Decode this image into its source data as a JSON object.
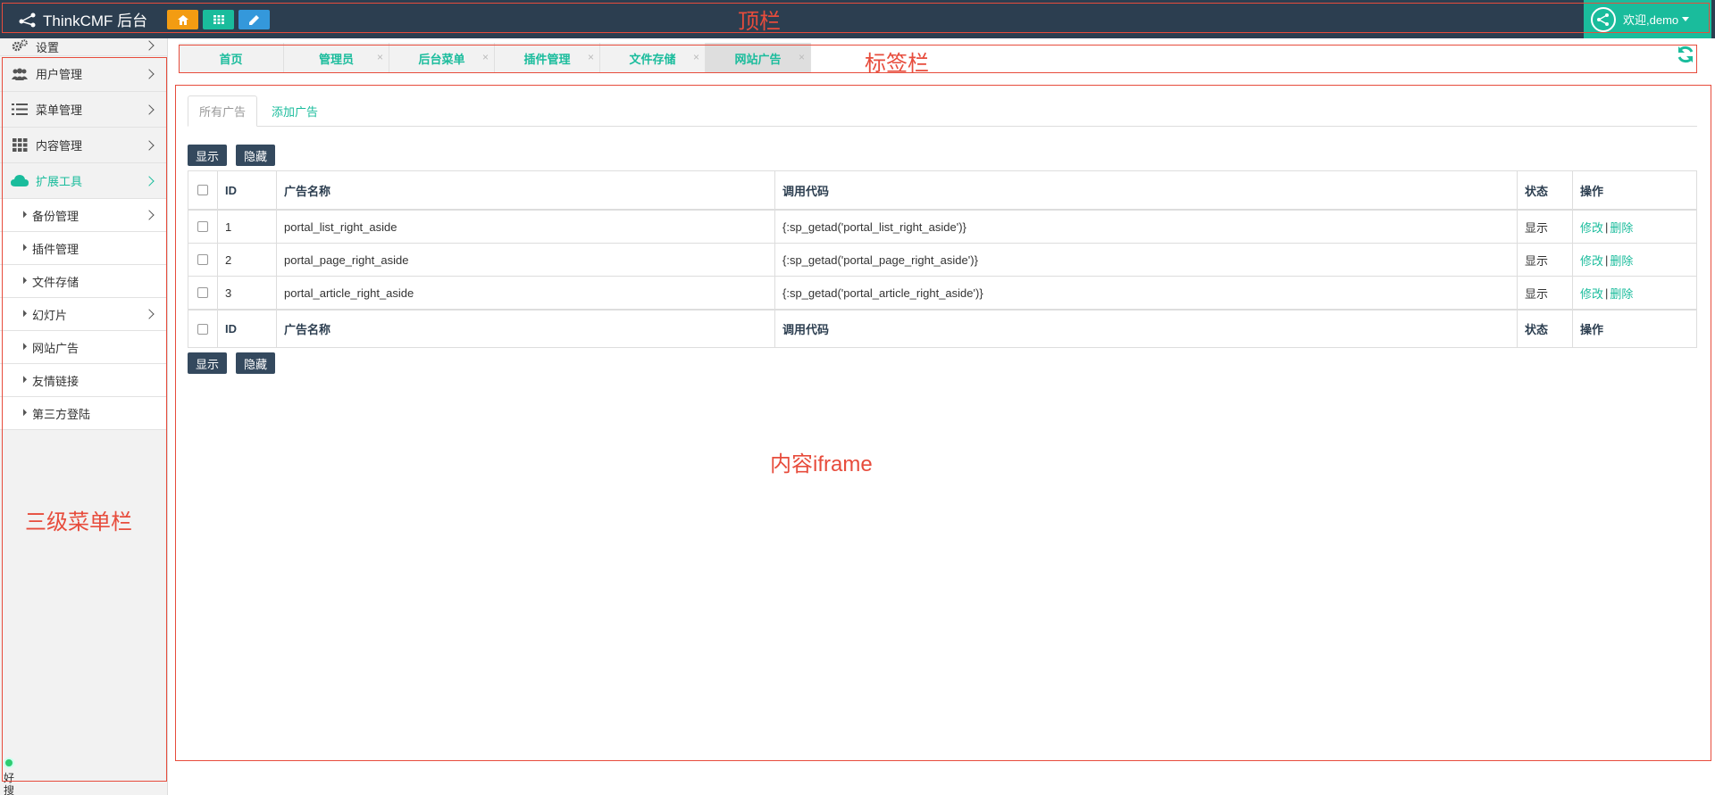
{
  "topbar": {
    "brand": "ThinkCMF 后台",
    "welcome": "欢迎,demo"
  },
  "sidebar": {
    "menus": [
      {
        "label": "设置",
        "icon": "gears-icon"
      },
      {
        "label": "用户管理",
        "icon": "users-icon"
      },
      {
        "label": "菜单管理",
        "icon": "list-icon"
      },
      {
        "label": "内容管理",
        "icon": "grid-icon"
      },
      {
        "label": "扩展工具",
        "icon": "cloud-icon"
      }
    ],
    "submenus": [
      {
        "label": "备份管理",
        "has_children": true
      },
      {
        "label": "插件管理",
        "has_children": false
      },
      {
        "label": "文件存储",
        "has_children": false
      },
      {
        "label": "幻灯片",
        "has_children": true
      },
      {
        "label": "网站广告",
        "has_children": false
      },
      {
        "label": "友情链接",
        "has_children": false
      },
      {
        "label": "第三方登陆",
        "has_children": false
      }
    ],
    "haosou": "好搜推荐"
  },
  "tabs": [
    {
      "label": "首页",
      "closable": false
    },
    {
      "label": "管理员",
      "closable": true
    },
    {
      "label": "后台菜单",
      "closable": true
    },
    {
      "label": "插件管理",
      "closable": true
    },
    {
      "label": "文件存储",
      "closable": true
    },
    {
      "label": "网站广告",
      "closable": true,
      "active": true
    }
  ],
  "tab_close_glyph": "×",
  "content": {
    "nav": {
      "all": "所有广告",
      "add": "添加广告"
    },
    "buttons": {
      "show": "显示",
      "hide": "隐藏"
    },
    "columns": {
      "id": "ID",
      "name": "广告名称",
      "code": "调用代码",
      "status": "状态",
      "ops": "操作"
    },
    "rows": [
      {
        "id": "1",
        "name": "portal_list_right_aside",
        "code": "{:sp_getad('portal_list_right_aside')}",
        "status": "显示",
        "edit": "修改",
        "delete": "删除"
      },
      {
        "id": "2",
        "name": "portal_page_right_aside",
        "code": "{:sp_getad('portal_page_right_aside')}",
        "status": "显示",
        "edit": "修改",
        "delete": "删除"
      },
      {
        "id": "3",
        "name": "portal_article_right_aside",
        "code": "{:sp_getad('portal_article_right_aside')}",
        "status": "显示",
        "edit": "修改",
        "delete": "删除"
      }
    ],
    "op_separator": "|"
  },
  "annotations": {
    "top": "顶栏",
    "tabs": "标签栏",
    "content": "内容iframe",
    "sidebar": "三级菜单栏",
    "color": "#e74c3c"
  },
  "colors": {
    "topbar": "#2c3e50",
    "accent": "#1abc9c",
    "home_btn": "#f39c12",
    "edit_btn": "#3498db",
    "dark_btn": "#34495e"
  }
}
